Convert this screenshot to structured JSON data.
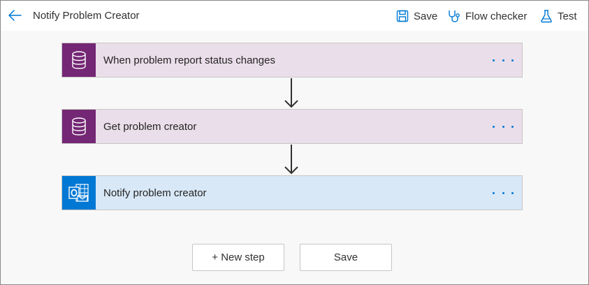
{
  "header": {
    "flow_title": "Notify Problem Creator",
    "commands": {
      "save": "Save",
      "flow_checker": "Flow checker",
      "test": "Test"
    }
  },
  "steps": [
    {
      "label": "When problem report status changes",
      "connector": "dataverse",
      "icon": "database-icon",
      "color": "#742774"
    },
    {
      "label": "Get problem creator",
      "connector": "dataverse",
      "icon": "database-icon",
      "color": "#742774"
    },
    {
      "label": "Notify problem creator",
      "connector": "outlook",
      "icon": "outlook-icon",
      "color": "#0078d4"
    }
  ],
  "footer": {
    "new_step": "+ New step",
    "save": "Save"
  },
  "colors": {
    "accent": "#0078d4",
    "dataverse": "#742774",
    "dataverse_bg": "#eadeea",
    "outlook_bg": "#d8e8f7"
  }
}
